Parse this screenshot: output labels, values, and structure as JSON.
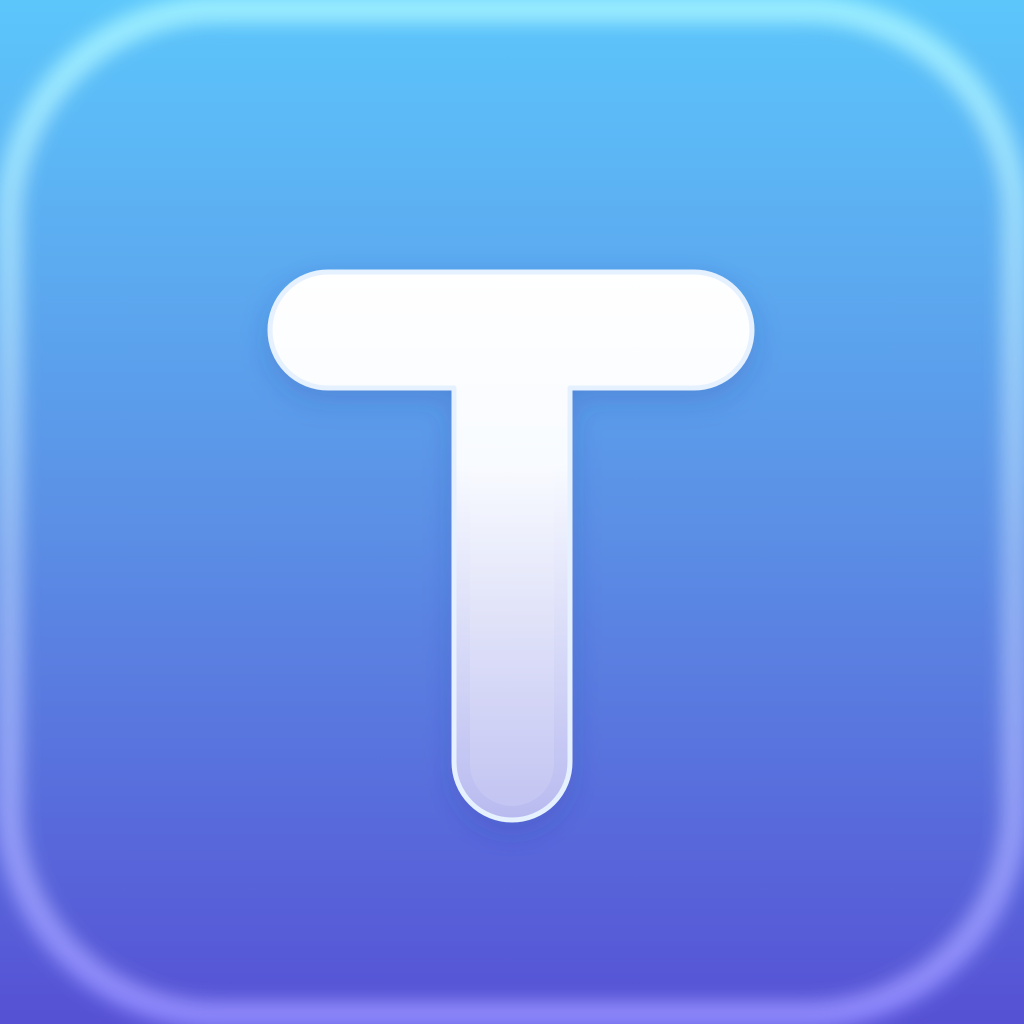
{
  "app_icon": {
    "glyph": "T",
    "glyph_icon": "letter-t-icon",
    "colors": {
      "gradient_top": "#5cc6fb",
      "gradient_middle": "#5b91e6",
      "gradient_bottom": "#5651d4",
      "rim_light_top": "#9cf0ff",
      "rim_light_bottom": "#8f88ff",
      "glyph_top": "#ffffff",
      "glyph_bottom": "#b8baf0"
    }
  }
}
